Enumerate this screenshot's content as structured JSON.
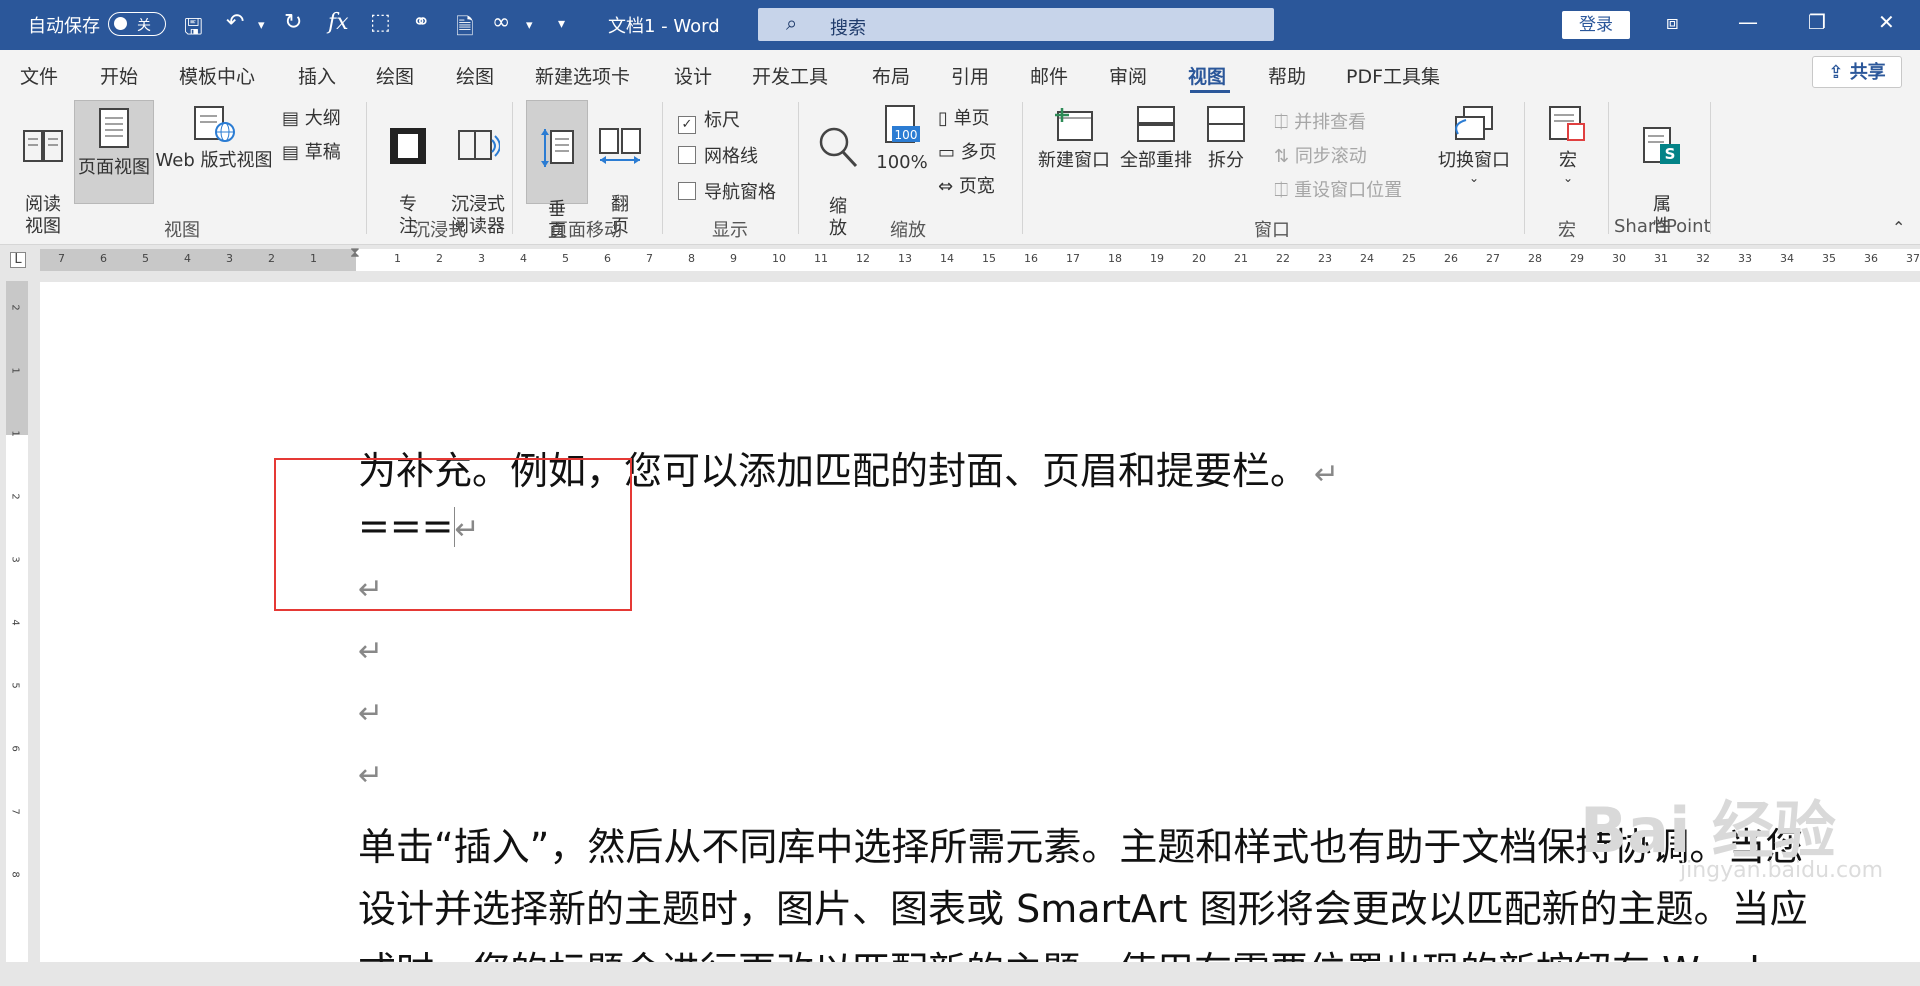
{
  "titlebar": {
    "autosave_label": "自动保存",
    "autosave_state": "关",
    "doc_title": "文档1 - Word",
    "search_placeholder": "搜索",
    "login_label": "登录"
  },
  "menu": {
    "items": [
      "文件",
      "开始",
      "模板中心",
      "插入",
      "绘图",
      "绘图",
      "新建选项卡",
      "设计",
      "开发工具",
      "布局",
      "引用",
      "邮件",
      "审阅",
      "视图",
      "帮助",
      "PDF工具集"
    ],
    "active": "视图",
    "share_label": "共享"
  },
  "ribbon": {
    "view_group": {
      "read_mode": "阅读\n视图",
      "print_layout": "页面视图",
      "web_layout": "Web 版式视图",
      "outline": "大纲",
      "draft": "草稿",
      "label": "视图"
    },
    "immersive_group": {
      "focus": "专\n注",
      "immersive_reader": "沉浸式\n阅读器",
      "label": "沉浸式"
    },
    "page_movement_group": {
      "vertical": "垂\n直",
      "side_to_side": "翻\n页",
      "label": "页面移动"
    },
    "show_group": {
      "ruler": "标尺",
      "ruler_checked": true,
      "gridlines": "网格线",
      "nav_pane": "导航窗格",
      "label": "显示"
    },
    "zoom_group": {
      "zoom": "缩\n放",
      "zoom_100": "100%",
      "zoom_100_badge": "100",
      "one_page": "单页",
      "multiple_pages": "多页",
      "page_width": "页宽",
      "label": "缩放"
    },
    "window_group": {
      "new_window": "新建窗口",
      "arrange_all": "全部重排",
      "split": "拆分",
      "side_by_side": "并排查看",
      "sync_scroll": "同步滚动",
      "reset_position": "重设窗口位置",
      "switch_windows": "切换窗口",
      "label": "窗口"
    },
    "macros_group": {
      "macros": "宏",
      "label": "宏"
    },
    "sharepoint_group": {
      "properties": "属\n性",
      "label": "SharePoint"
    }
  },
  "ruler": {
    "left_ticks": [
      "7",
      "6",
      "5",
      "4",
      "3",
      "2",
      "1"
    ],
    "right_ticks": [
      "1",
      "2",
      "3",
      "4",
      "5",
      "6",
      "7",
      "8",
      "9",
      "10",
      "11",
      "12",
      "13",
      "14",
      "15",
      "16",
      "17",
      "18",
      "19",
      "20",
      "21",
      "22",
      "23",
      "24",
      "25",
      "26",
      "27",
      "28",
      "29",
      "30",
      "31",
      "32",
      "33",
      "34",
      "35",
      "36",
      "37"
    ]
  },
  "vruler": {
    "ticks": [
      "2",
      "1",
      "1",
      "2",
      "3",
      "4",
      "5",
      "6",
      "7",
      "8"
    ]
  },
  "document": {
    "line1": "为补充。例如，您可以添加匹配的封面、页眉和提要栏。",
    "line2": "===",
    "paragraph_mark": "↵",
    "para1": "单击“插入”，然后从不同库中选择所需元素。主题和样式也有助于文档保持协调。当您",
    "para2": "设计并选择新的主题时，图片、图表或 SmartArt 图形将会更改以匹配新的主题。当应",
    "para3": "式时，您的标题会进行更改以匹配新的主题。使用在需要位置出现的新按钮在 Word"
  },
  "watermark": {
    "text": "Bai 经验",
    "sub": "jingyan.baidu.com"
  }
}
